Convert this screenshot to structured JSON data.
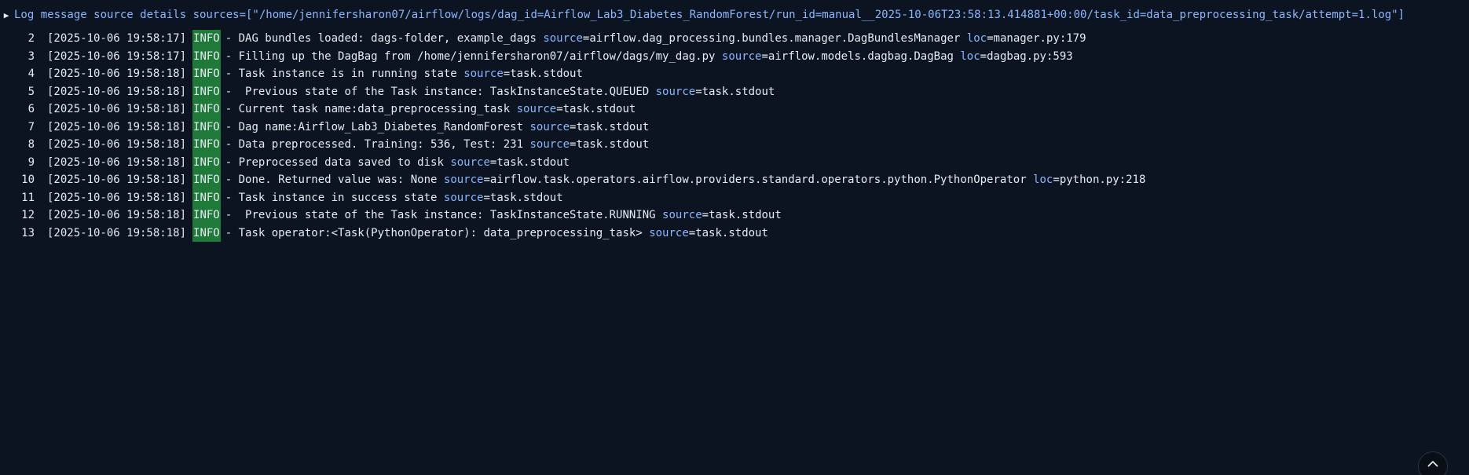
{
  "summary": {
    "label": "Log message source details sources=[\"/home/jennifersharon07/airflow/logs/dag_id=Airflow_Lab3_Diabetes_RandomForest/run_id=manual__2025-10-06T23:58:13.414881+00:00/task_id=data_preprocessing_task/attempt=1.log\"]"
  },
  "log": {
    "lines": [
      {
        "num": "2",
        "ts": "[2025-10-06 19:58:17]",
        "level": "INFO",
        "msg": "- DAG bundles loaded: dags-folder, example_dags",
        "source": "airflow.dag_processing.bundles.manager.DagBundlesManager",
        "loc": "manager.py:179"
      },
      {
        "num": "3",
        "ts": "[2025-10-06 19:58:17]",
        "level": "INFO",
        "msg": "- Filling up the DagBag from /home/jennifersharon07/airflow/dags/my_dag.py",
        "source": "airflow.models.dagbag.DagBag",
        "loc": "dagbag.py:593"
      },
      {
        "num": "4",
        "ts": "[2025-10-06 19:58:18]",
        "level": "INFO",
        "msg": "- Task instance is in running state",
        "source": "task.stdout",
        "loc": null
      },
      {
        "num": "5",
        "ts": "[2025-10-06 19:58:18]",
        "level": "INFO",
        "msg": "-  Previous state of the Task instance: TaskInstanceState.QUEUED",
        "source": "task.stdout",
        "loc": null
      },
      {
        "num": "6",
        "ts": "[2025-10-06 19:58:18]",
        "level": "INFO",
        "msg": "- Current task name:data_preprocessing_task",
        "source": "task.stdout",
        "loc": null
      },
      {
        "num": "7",
        "ts": "[2025-10-06 19:58:18]",
        "level": "INFO",
        "msg": "- Dag name:Airflow_Lab3_Diabetes_RandomForest",
        "source": "task.stdout",
        "loc": null
      },
      {
        "num": "8",
        "ts": "[2025-10-06 19:58:18]",
        "level": "INFO",
        "msg": "- Data preprocessed. Training: 536, Test: 231",
        "source": "task.stdout",
        "loc": null
      },
      {
        "num": "9",
        "ts": "[2025-10-06 19:58:18]",
        "level": "INFO",
        "msg": "- Preprocessed data saved to disk",
        "source": "task.stdout",
        "loc": null
      },
      {
        "num": "10",
        "ts": "[2025-10-06 19:58:18]",
        "level": "INFO",
        "msg": "- Done. Returned value was: None",
        "source": "airflow.task.operators.airflow.providers.standard.operators.python.PythonOperator",
        "loc": "python.py:218"
      },
      {
        "num": "11",
        "ts": "[2025-10-06 19:58:18]",
        "level": "INFO",
        "msg": "- Task instance in success state",
        "source": "task.stdout",
        "loc": null
      },
      {
        "num": "12",
        "ts": "[2025-10-06 19:58:18]",
        "level": "INFO",
        "msg": "-  Previous state of the Task instance: TaskInstanceState.RUNNING",
        "source": "task.stdout",
        "loc": null
      },
      {
        "num": "13",
        "ts": "[2025-10-06 19:58:18]",
        "level": "INFO",
        "msg": "- Task operator:<Task(PythonOperator): data_preprocessing_task>",
        "source": "task.stdout",
        "loc": null
      }
    ],
    "source_key": "source",
    "loc_key": "loc"
  },
  "scroll_top": {
    "icon": "chevron-up-icon"
  },
  "colors": {
    "background": "#0d1421",
    "info_badge": "#1f7a3a",
    "key_blue": "#8ab7ff",
    "text": "#e6ebf2"
  }
}
